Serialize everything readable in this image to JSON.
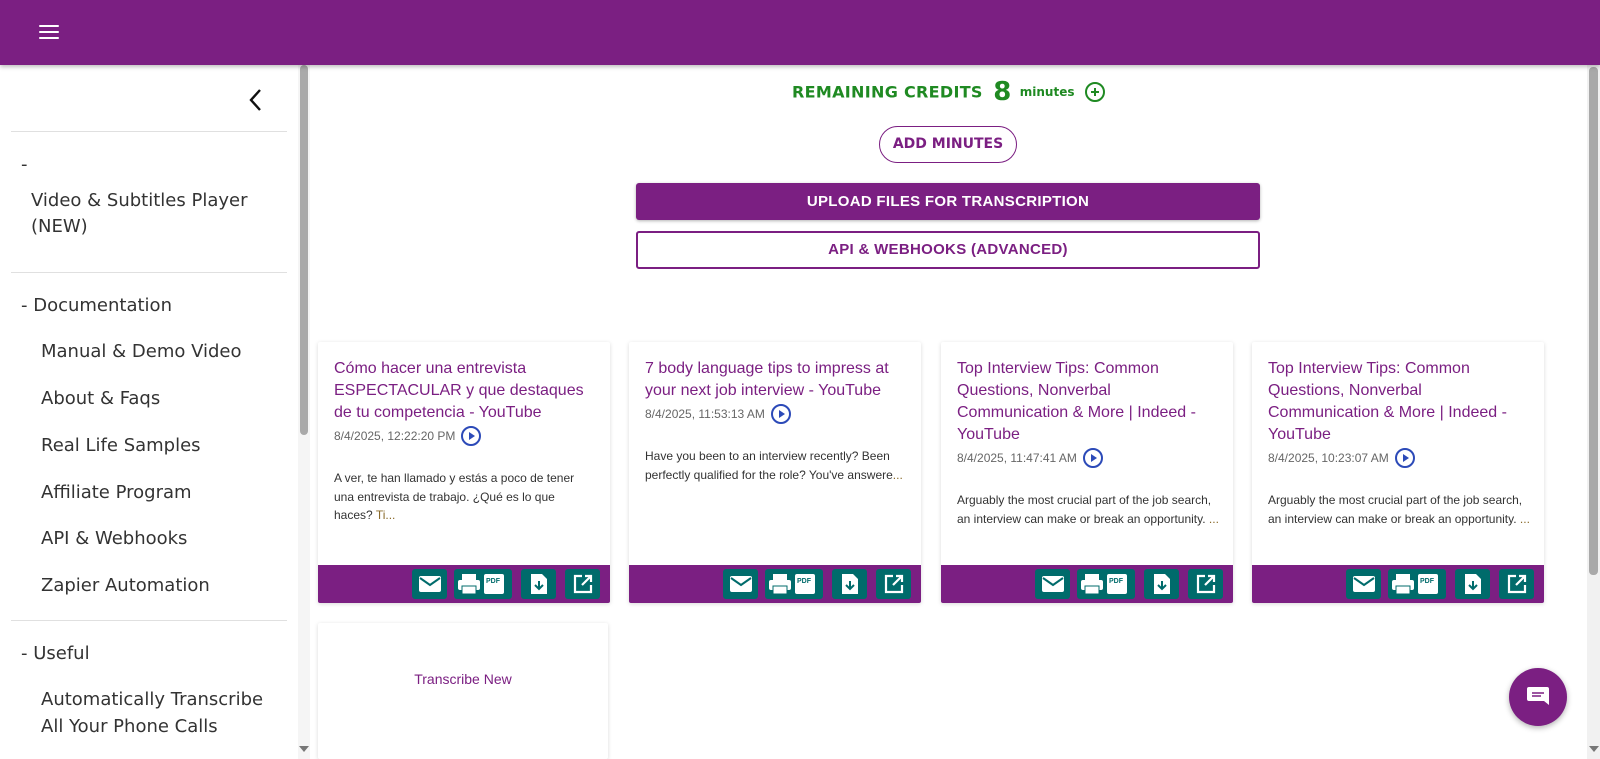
{
  "colors": {
    "brand": "#7b1f82",
    "credits": "#1f8a22",
    "action": "#006b6b",
    "play": "#2c4ab8"
  },
  "topbar": {
    "menu_icon": "hamburger-menu-icon"
  },
  "sidebar": {
    "collapse_icon": "chevron-left-icon",
    "sections": [
      {
        "header": "-",
        "items": [
          "Video & Subtitles Player",
          "(NEW)"
        ]
      },
      {
        "header": "- Documentation",
        "items": [
          "Manual & Demo Video",
          "About & Faqs",
          "Real Life Samples",
          "Affiliate Program",
          "API & Webhooks",
          "Zapier Automation"
        ]
      },
      {
        "header": "- Useful",
        "items": [
          "Automatically Transcribe",
          "All Your Phone Calls"
        ]
      }
    ]
  },
  "credits": {
    "label": "REMAINING CREDITS",
    "value": "8",
    "unit": "minutes",
    "add_icon": "plus-circle-icon"
  },
  "buttons": {
    "add_minutes": "ADD MINUTES",
    "upload": "UPLOAD FILES FOR TRANSCRIPTION",
    "api": "API & WEBHOOKS (ADVANCED)"
  },
  "cards": [
    {
      "title": "Cómo hacer una entrevista ESPECTACULAR y que destaques de tu competencia - YouTube",
      "date": "8/4/2025, 12:22:20 PM",
      "desc": "A ver, te han llamado y estás a poco de tener una entrevista de trabajo. ¿Qué es lo que haces? ",
      "more": "Ti..."
    },
    {
      "title": "7 body language tips to impress at your next job interview - YouTube",
      "date": "8/4/2025, 11:53:13 AM",
      "desc": "Have you been to an interview recently? Been perfectly qualified for the role? You've answere",
      "more": "..."
    },
    {
      "title": "Top Interview Tips: Common Questions, Nonverbal Communication & More | Indeed - YouTube",
      "date": "8/4/2025, 11:47:41 AM",
      "desc": "Arguably the most crucial part of the job search, an interview can make or break an opportunity. ",
      "more": "..."
    },
    {
      "title": "Top Interview Tips: Common Questions, Nonverbal Communication & More | Indeed - YouTube",
      "date": "8/4/2025, 10:23:07 AM",
      "desc": "Arguably the most crucial part of the job search, an interview can make or break an opportunity. ",
      "more": "..."
    }
  ],
  "card_actions": [
    "email-icon",
    "print-pdf-icon",
    "download-icon",
    "open-external-icon"
  ],
  "transcribe_new": "Transcribe New",
  "chat": {
    "icon": "chat-bubble-icon"
  }
}
